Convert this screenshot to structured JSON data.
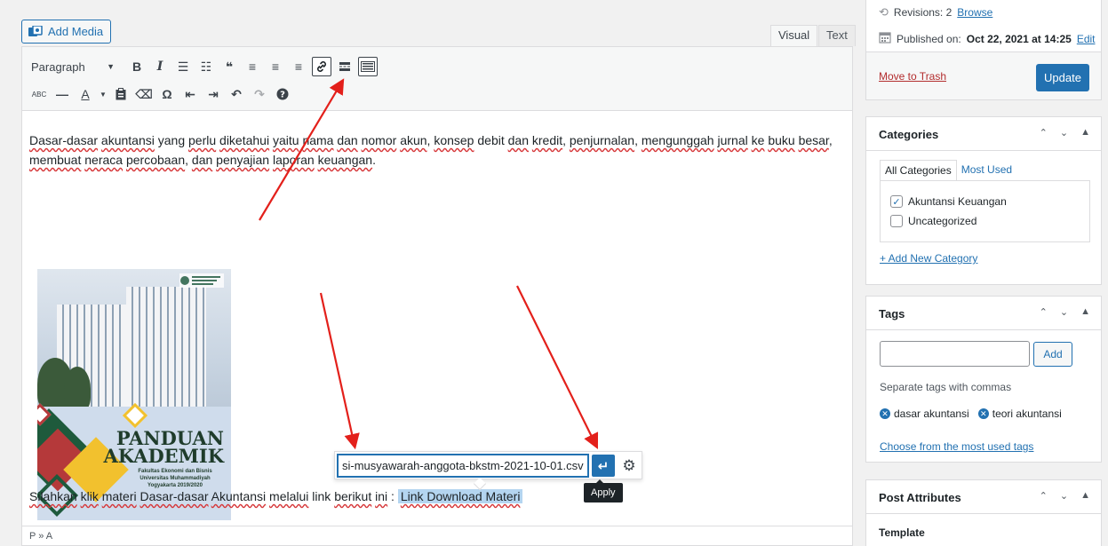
{
  "editor": {
    "add_media_label": "Add Media",
    "tabs": {
      "visual": "Visual",
      "text": "Text"
    },
    "format_select": "Paragraph",
    "paragraph1_words": [
      {
        "t": "Dasar-dasar",
        "sq": true
      },
      {
        "t": " ",
        "sq": false
      },
      {
        "t": "akuntansi",
        "sq": true
      },
      {
        "t": " yang ",
        "sq": false
      },
      {
        "t": "perlu",
        "sq": true
      },
      {
        "t": " ",
        "sq": false
      },
      {
        "t": "diketahui",
        "sq": true
      },
      {
        "t": " ",
        "sq": false
      },
      {
        "t": "yaitu",
        "sq": true
      },
      {
        "t": " ",
        "sq": false
      },
      {
        "t": "nama",
        "sq": true
      },
      {
        "t": " ",
        "sq": false
      },
      {
        "t": "dan",
        "sq": true
      },
      {
        "t": " ",
        "sq": false
      },
      {
        "t": "nomor",
        "sq": true
      },
      {
        "t": " ",
        "sq": false
      },
      {
        "t": "akun",
        "sq": true
      },
      {
        "t": ", ",
        "sq": false
      },
      {
        "t": "konsep",
        "sq": true
      },
      {
        "t": " debit ",
        "sq": false
      },
      {
        "t": "dan",
        "sq": true
      },
      {
        "t": " ",
        "sq": false
      },
      {
        "t": "kredit",
        "sq": true
      },
      {
        "t": ", ",
        "sq": false
      },
      {
        "t": "penjurnalan",
        "sq": true
      },
      {
        "t": ", ",
        "sq": false
      },
      {
        "t": "mengunggah",
        "sq": true
      },
      {
        "t": " ",
        "sq": false
      },
      {
        "t": "jurnal",
        "sq": true
      },
      {
        "t": " ",
        "sq": false
      },
      {
        "t": "ke",
        "sq": true
      },
      {
        "t": " ",
        "sq": false
      },
      {
        "t": "buku",
        "sq": true
      },
      {
        "t": " ",
        "sq": false
      },
      {
        "t": "besar",
        "sq": true
      },
      {
        "t": ", ",
        "sq": false
      },
      {
        "t": "membuat",
        "sq": true
      },
      {
        "t": " ",
        "sq": false
      },
      {
        "t": "neraca",
        "sq": true
      },
      {
        "t": " ",
        "sq": false
      },
      {
        "t": "percobaan",
        "sq": true
      },
      {
        "t": ", ",
        "sq": false
      },
      {
        "t": "dan",
        "sq": true
      },
      {
        "t": " ",
        "sq": false
      },
      {
        "t": "penyajian",
        "sq": true
      },
      {
        "t": " ",
        "sq": false
      },
      {
        "t": "laporan",
        "sq": true
      },
      {
        "t": " ",
        "sq": false
      },
      {
        "t": "keuangan",
        "sq": true
      },
      {
        "t": ".",
        "sq": false
      }
    ],
    "paragraph2_words": [
      {
        "t": "Silahkan",
        "sq": true
      },
      {
        "t": " ",
        "sq": false
      },
      {
        "t": "klik",
        "sq": true
      },
      {
        "t": " ",
        "sq": false
      },
      {
        "t": "materi",
        "sq": true
      },
      {
        "t": " ",
        "sq": false
      },
      {
        "t": "Dasar-dasar",
        "sq": true
      },
      {
        "t": " ",
        "sq": false
      },
      {
        "t": "Akuntansi",
        "sq": true
      },
      {
        "t": " ",
        "sq": false
      },
      {
        "t": "melalui",
        "sq": true
      },
      {
        "t": " link ",
        "sq": false
      },
      {
        "t": "berikut",
        "sq": true
      },
      {
        "t": " ",
        "sq": false
      },
      {
        "t": "ini",
        "sq": true
      },
      {
        "t": " : ",
        "sq": false
      }
    ],
    "link_text": "Link Download Materi",
    "cover": {
      "title_line1": "PANDUAN",
      "title_line2": "AKADEMIK",
      "subtitle": "Fakultas Ekonomi dan Bisnis Universitas Muhammadiyah Yogyakarta 2019/2020",
      "colors": {
        "green": "#1e5a3c",
        "red": "#b5393a",
        "yellow": "#f2c12e"
      }
    },
    "link_popup": {
      "url_value": "si-musyawarah-anggota-bkstm-2021-10-01.csv",
      "apply_tooltip": "Apply"
    },
    "path_bar": "P » A"
  },
  "sidebar": {
    "publish": {
      "revisions_label": "Revisions: 2",
      "browse_link": "Browse",
      "published_label": "Published on:",
      "published_date": "Oct 22, 2021 at 14:25",
      "edit_link": "Edit",
      "trash_link": "Move to Trash",
      "update_button": "Update"
    },
    "categories": {
      "title": "Categories",
      "tab_all": "All Categories",
      "tab_most_used": "Most Used",
      "items": [
        {
          "label": "Akuntansi Keuangan",
          "checked": true
        },
        {
          "label": "Uncategorized",
          "checked": false
        }
      ],
      "add_new": "+ Add New Category"
    },
    "tags": {
      "title": "Tags",
      "input_value": "",
      "add_button": "Add",
      "hint": "Separate tags with commas",
      "items": [
        "dasar akuntansi",
        "teori akuntansi"
      ],
      "choose_link": "Choose from the most used tags"
    },
    "post_attributes": {
      "title": "Post Attributes",
      "template_label": "Template"
    }
  },
  "colors": {
    "accent": "#2271b1",
    "annotation_arrow": "#e3201b",
    "trash": "#b32d2e"
  }
}
